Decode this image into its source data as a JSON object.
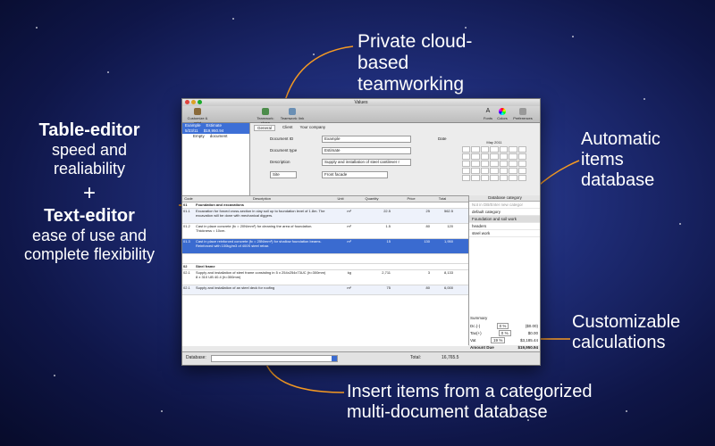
{
  "promo": {
    "cloud": "Private cloud-based teamworking",
    "table_editor_title": "Table-editor",
    "table_editor_sub": "speed and realiability",
    "plus": "+",
    "text_editor_title": "Text-editor",
    "text_editor_sub": "ease of use and complete flexibility",
    "auto_db": "Automatic items database",
    "custom_calc": "Customizable calculations",
    "insert_items": "Insert items from a categorized multi-document database"
  },
  "window": {
    "title": "Values",
    "toolbar": {
      "customize": "Customize & print",
      "teamwork_share": "Teamwork: share",
      "teamwork_link": "Teamwork: link",
      "fonts": "Fonts",
      "colors": "Colors",
      "preferences": "Preferences"
    },
    "sidebar": {
      "rows": [
        {
          "a": "Example",
          "b": "Estimate",
          "selected": true
        },
        {
          "a": "5/23/11",
          "b": "$19,950.94",
          "selected": true
        },
        {
          "a": "Empty",
          "b": "document",
          "selected": false
        }
      ]
    },
    "tabs": [
      "General",
      "Client",
      "Your company"
    ],
    "form": {
      "doc_id_label": "Document ID",
      "doc_id_value": "Example",
      "doc_type_label": "Document type",
      "doc_type_value": "Estimate",
      "description_label": "Description",
      "description_value": "Supply and installation of steel cantilever r",
      "site_value": "Site",
      "site_text": "Front facade",
      "date_label": "Date",
      "cal_month": "May 2011"
    },
    "grid": {
      "headers": [
        "Code",
        "Description",
        "Unit",
        "Quantity",
        "Price",
        "Total"
      ],
      "rows": [
        {
          "code": "01",
          "desc": "Foundation and excavations",
          "unit": "",
          "qty": "",
          "price": "",
          "total": "",
          "style": "header"
        },
        {
          "code": "01.1",
          "desc": "Excavation for forced cross-section in clay soil up to foundation level of 1.8m. The excavation will be done with mechanical diggers.",
          "unit": "m³",
          "qty": "22.5",
          "price": "25",
          "total": "562.5",
          "style": "alt"
        },
        {
          "code": "01.2",
          "desc": "Cast in place concrete (fc = 20N/mm²) for cleaning the area of foundation. Thickness = 10cm.",
          "unit": "m³",
          "qty": "1.5",
          "price": "80",
          "total": "120",
          "style": ""
        },
        {
          "code": "01.3",
          "desc": "Cast in place reinforced concrete (fc = 25N/mm²) for shallow foundation beams. Reinforced with 100kg/m3 of 400S steel rebar.",
          "unit": "m³",
          "qty": "15",
          "price": "130",
          "total": "1,950",
          "style": "sel"
        },
        {
          "code": "",
          "desc": "",
          "unit": "",
          "qty": "",
          "price": "",
          "total": "",
          "style": ""
        },
        {
          "code": "02",
          "desc": "Steel frame",
          "unit": "",
          "qty": "",
          "price": "",
          "total": "",
          "style": "header"
        },
        {
          "code": "02.1",
          "desc": "Supply and installation of steel frame consisting in 5 x 254x254x73UC (h=300mm) 8 x 310 UB 40.4 (h=300mm)",
          "unit": "kg",
          "qty": "2,711",
          "price": "3",
          "total": "8,133",
          "style": ""
        },
        {
          "code": "02.1",
          "desc": "Supply and installation of an steel deck for roofing",
          "unit": "m²",
          "qty": "75",
          "price": "80",
          "total": "6,000",
          "style": "alt"
        }
      ]
    },
    "db_panel": {
      "header": "Database category",
      "hint": "Not in DB/Enter new categor",
      "items": [
        {
          "label": "default category",
          "selected": false
        },
        {
          "label": "Foundation and soil work",
          "selected": true
        },
        {
          "label": "headers",
          "selected": false
        },
        {
          "label": "steel work",
          "selected": false
        }
      ]
    },
    "summary": {
      "title": "Summary",
      "dc_label": "Dc.(-)",
      "dc_value": "0",
      "dc_unit": "%",
      "dc_amount": "($0.00)",
      "tax_label": "Tax(+)",
      "tax_value": "0",
      "tax_unit": "%",
      "tax_amount": "$0.00",
      "vat_label": "Vat",
      "vat_value": "19",
      "vat_unit": "%",
      "vat_amount": "$3,185.44",
      "amount_due_label": "Amount Due",
      "amount_due_value": "$19,950.94"
    },
    "bottom": {
      "database_label": "Database:",
      "total_label": "Total:",
      "total_value": "16,765.5"
    }
  }
}
